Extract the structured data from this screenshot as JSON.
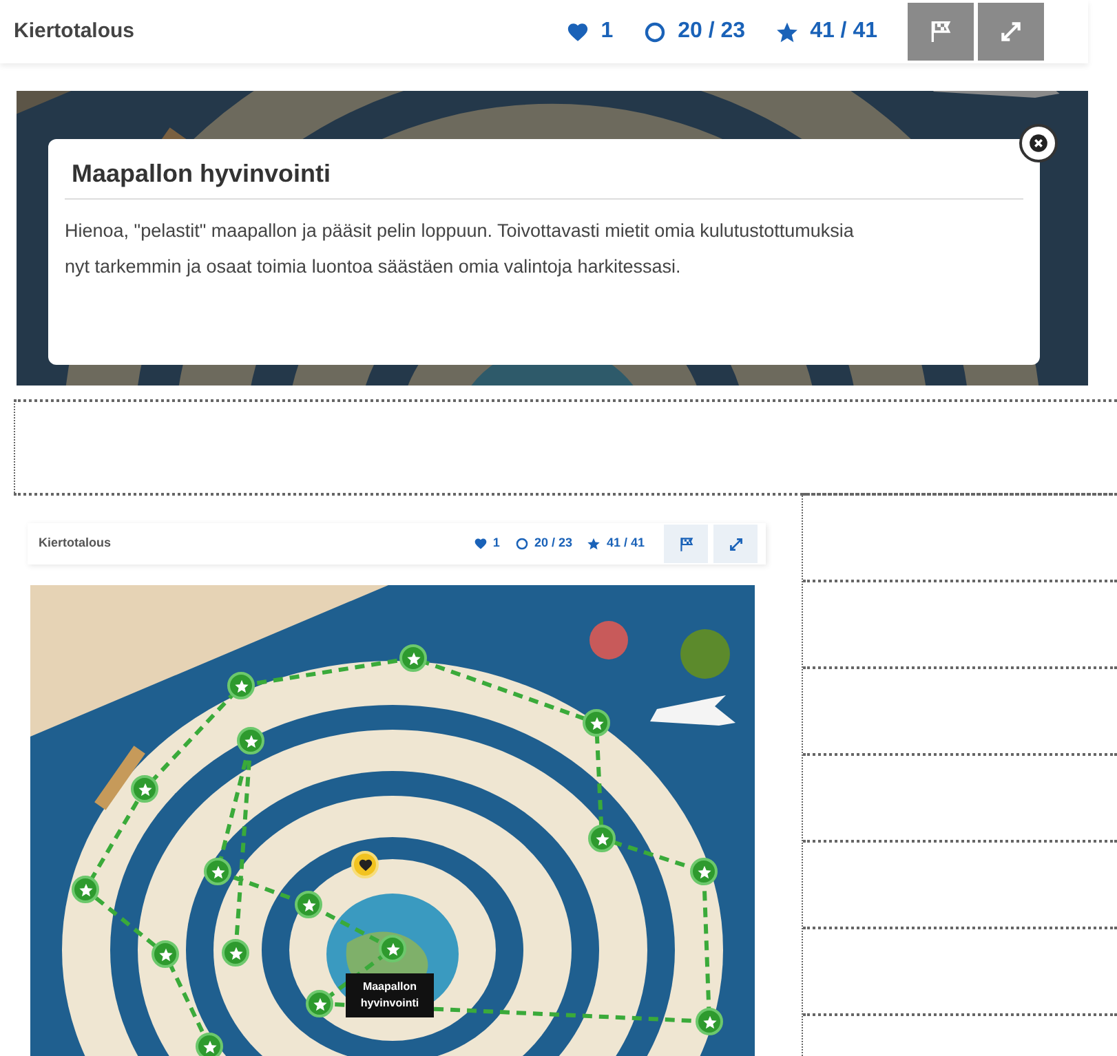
{
  "main_view": {
    "title": "Kiertotalous",
    "stats": [
      {
        "kind": "heart",
        "text": "1"
      },
      {
        "kind": "circle",
        "text": "20 / 23"
      },
      {
        "kind": "star",
        "text": "41 / 41"
      }
    ],
    "buttons": [
      {
        "kind": "flag"
      },
      {
        "kind": "expand"
      }
    ],
    "dialog": {
      "title": "Maapallon hyvinvointi",
      "body": "Hienoa, \"pelastit\" maapallon ja pääsit pelin loppuun. Toivottavasti mietit omia kulutustottumuksia nyt tarkemmin ja osaat toimia luontoa säästäen omia valintoja harkitessasi."
    }
  },
  "preview_view": {
    "title": "Kiertotalous",
    "stats": [
      {
        "kind": "heart",
        "text": "1"
      },
      {
        "kind": "circle",
        "text": "20 / 23"
      },
      {
        "kind": "star",
        "text": "41 / 41"
      }
    ],
    "buttons": [
      {
        "kind": "flag"
      },
      {
        "kind": "expand"
      }
    ],
    "markers": [
      {
        "kind": "star"
      },
      {
        "kind": "star"
      },
      {
        "kind": "star"
      },
      {
        "kind": "star"
      },
      {
        "kind": "star"
      },
      {
        "kind": "star"
      },
      {
        "kind": "star"
      },
      {
        "kind": "star"
      },
      {
        "kind": "star"
      },
      {
        "kind": "star"
      },
      {
        "kind": "star"
      },
      {
        "kind": "star"
      },
      {
        "kind": "star"
      },
      {
        "kind": "star"
      },
      {
        "kind": "star"
      },
      {
        "kind": "star"
      },
      {
        "kind": "heart"
      }
    ],
    "tooltip": "Maapallon hyvinvointi"
  }
}
